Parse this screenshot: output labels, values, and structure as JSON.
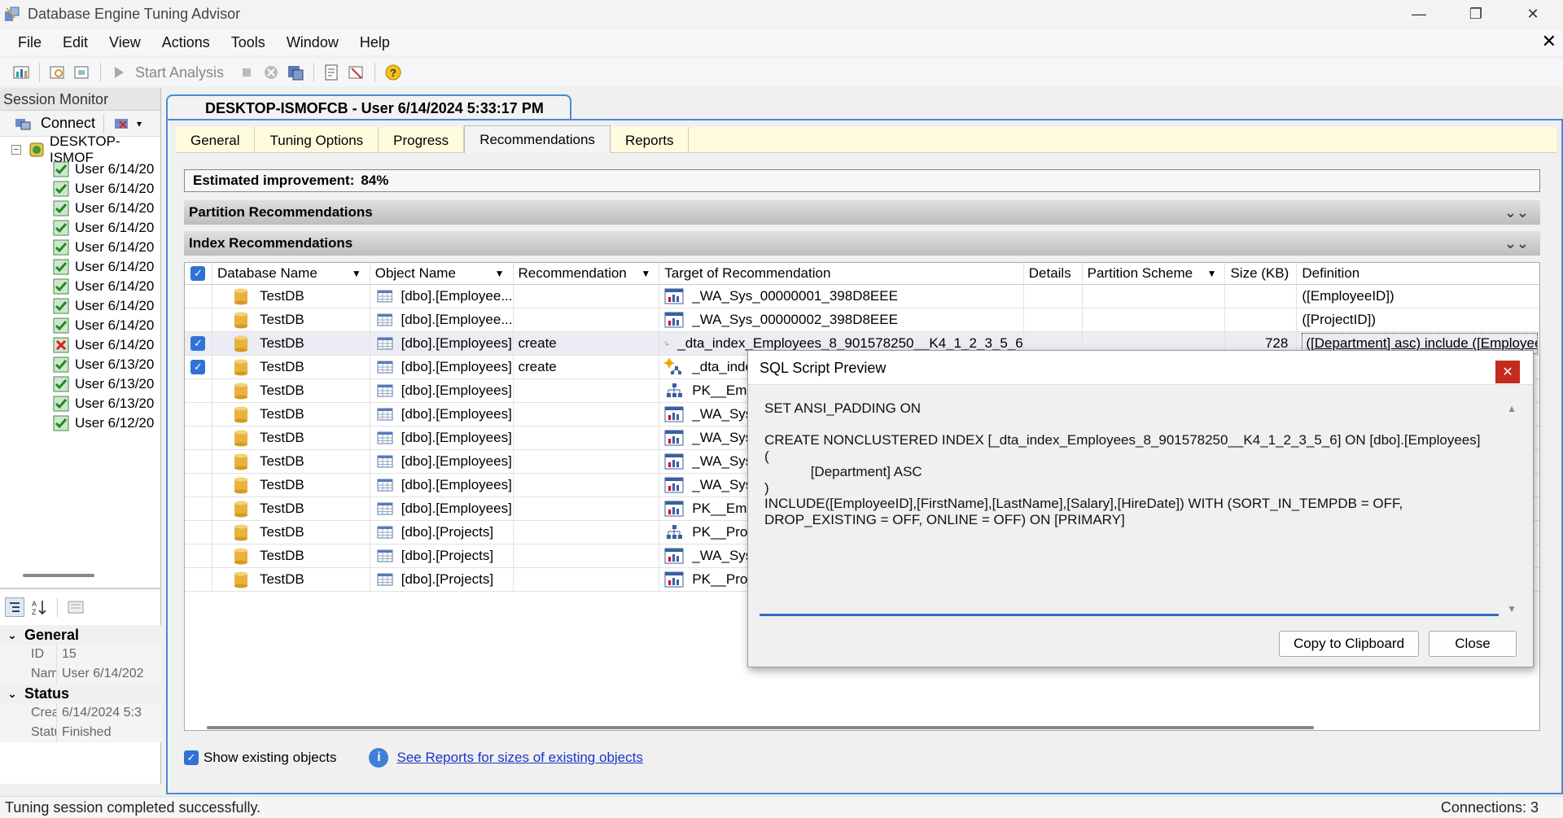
{
  "window": {
    "title": "Database Engine Tuning Advisor"
  },
  "menu": [
    "File",
    "Edit",
    "View",
    "Actions",
    "Tools",
    "Window",
    "Help"
  ],
  "toolbar": {
    "start_analysis": "Start Analysis"
  },
  "session_monitor": {
    "title": "Session Monitor",
    "connect_label": "Connect",
    "server_label": "DESKTOP-ISMOF",
    "sessions": [
      {
        "label": "User 6/14/20",
        "status": "ok"
      },
      {
        "label": "User 6/14/20",
        "status": "ok"
      },
      {
        "label": "User 6/14/20",
        "status": "ok"
      },
      {
        "label": "User 6/14/20",
        "status": "ok"
      },
      {
        "label": "User 6/14/20",
        "status": "ok"
      },
      {
        "label": "User 6/14/20",
        "status": "ok"
      },
      {
        "label": "User 6/14/20",
        "status": "ok"
      },
      {
        "label": "User 6/14/20",
        "status": "ok"
      },
      {
        "label": "User 6/14/20",
        "status": "ok"
      },
      {
        "label": "User 6/14/20",
        "status": "error"
      },
      {
        "label": "User 6/13/20",
        "status": "ok"
      },
      {
        "label": "User 6/13/20",
        "status": "ok"
      },
      {
        "label": "User 6/13/20",
        "status": "ok"
      },
      {
        "label": "User 6/12/20",
        "status": "ok"
      }
    ]
  },
  "properties": {
    "general_label": "General",
    "id_key": "ID",
    "id_value": "15",
    "name_key": "Name",
    "name_value": "User 6/14/202",
    "status_label": "Status",
    "creation_key": "Creatic",
    "creation_value": "6/14/2024 5:3",
    "status_key": "Status",
    "status_value": "Finished"
  },
  "session_tab": {
    "title": "DESKTOP-ISMOFCB - User 6/14/2024 5:33:17 PM"
  },
  "tabs": [
    "General",
    "Tuning Options",
    "Progress",
    "Recommendations",
    "Reports"
  ],
  "estimated": {
    "label": "Estimated improvement:",
    "value": "84%"
  },
  "partition_section": "Partition Recommendations",
  "index_section": "Index Recommendations",
  "grid": {
    "columns": [
      "Database Name",
      "Object Name",
      "Recommendation",
      "Target of Recommendation",
      "Details",
      "Partition Scheme",
      "Size (KB)",
      "Definition"
    ],
    "rows": [
      {
        "checked": false,
        "db": "TestDB",
        "obj": "[dbo].[Employee...",
        "rec": "",
        "target": "_WA_Sys_00000001_398D8EEE",
        "ticon": "stats",
        "size": "",
        "def": "([EmployeeID])"
      },
      {
        "checked": false,
        "db": "TestDB",
        "obj": "[dbo].[Employee...",
        "rec": "",
        "target": "_WA_Sys_00000002_398D8EEE",
        "ticon": "stats",
        "size": "",
        "def": "([ProjectID])"
      },
      {
        "checked": true,
        "db": "TestDB",
        "obj": "[dbo].[Employees]",
        "rec": "create",
        "target": "_dta_index_Employees_8_901578250__K4_1_2_3_5_6",
        "ticon": "newindex",
        "size": "728",
        "def": "([Department] asc) include ([EmployeeID], [Fi"
      },
      {
        "checked": true,
        "db": "TestDB",
        "obj": "[dbo].[Employees]",
        "rec": "create",
        "target": "_dta_index_Er",
        "ticon": "newindex",
        "size": "",
        "def": ""
      },
      {
        "checked": false,
        "db": "TestDB",
        "obj": "[dbo].[Employees]",
        "rec": "",
        "target": "PK__Employe",
        "ticon": "index",
        "size": "",
        "def": ""
      },
      {
        "checked": false,
        "db": "TestDB",
        "obj": "[dbo].[Employees]",
        "rec": "",
        "target": "_WA_Sys_000",
        "ticon": "stats",
        "size": "",
        "def": ""
      },
      {
        "checked": false,
        "db": "TestDB",
        "obj": "[dbo].[Employees]",
        "rec": "",
        "target": "_WA_Sys_000",
        "ticon": "stats",
        "size": "",
        "def": ""
      },
      {
        "checked": false,
        "db": "TestDB",
        "obj": "[dbo].[Employees]",
        "rec": "",
        "target": "_WA_Sys_000",
        "ticon": "stats",
        "size": "",
        "def": ""
      },
      {
        "checked": false,
        "db": "TestDB",
        "obj": "[dbo].[Employees]",
        "rec": "",
        "target": "_WA_Sys_000",
        "ticon": "stats",
        "size": "",
        "def": ""
      },
      {
        "checked": false,
        "db": "TestDB",
        "obj": "[dbo].[Employees]",
        "rec": "",
        "target": "PK__Employe",
        "ticon": "stats",
        "size": "",
        "def": ""
      },
      {
        "checked": false,
        "db": "TestDB",
        "obj": "[dbo].[Projects]",
        "rec": "",
        "target": "PK__Projects_",
        "ticon": "index",
        "size": "",
        "def": ""
      },
      {
        "checked": false,
        "db": "TestDB",
        "obj": "[dbo].[Projects]",
        "rec": "",
        "target": "_WA_Sys_000",
        "ticon": "stats",
        "size": "",
        "def": ""
      },
      {
        "checked": false,
        "db": "TestDB",
        "obj": "[dbo].[Projects]",
        "rec": "",
        "target": "PK__Projects_",
        "ticon": "stats",
        "size": "",
        "def": ""
      }
    ]
  },
  "bottom": {
    "show_existing": "Show existing objects",
    "reports_link": "See Reports for sizes of existing objects"
  },
  "dialog": {
    "title": "SQL Script Preview",
    "script": "SET ANSI_PADDING ON\n\nCREATE NONCLUSTERED INDEX [_dta_index_Employees_8_901578250__K4_1_2_3_5_6] ON [dbo].[Employees]\n(\n            [Department] ASC\n)\nINCLUDE([EmployeeID],[FirstName],[LastName],[Salary],[HireDate]) WITH (SORT_IN_TEMPDB = OFF, DROP_EXISTING = OFF, ONLINE = OFF) ON [PRIMARY]",
    "copy_label": "Copy to Clipboard",
    "close_label": "Close"
  },
  "status": {
    "message": "Tuning session completed successfully.",
    "connections": "Connections: 3"
  }
}
